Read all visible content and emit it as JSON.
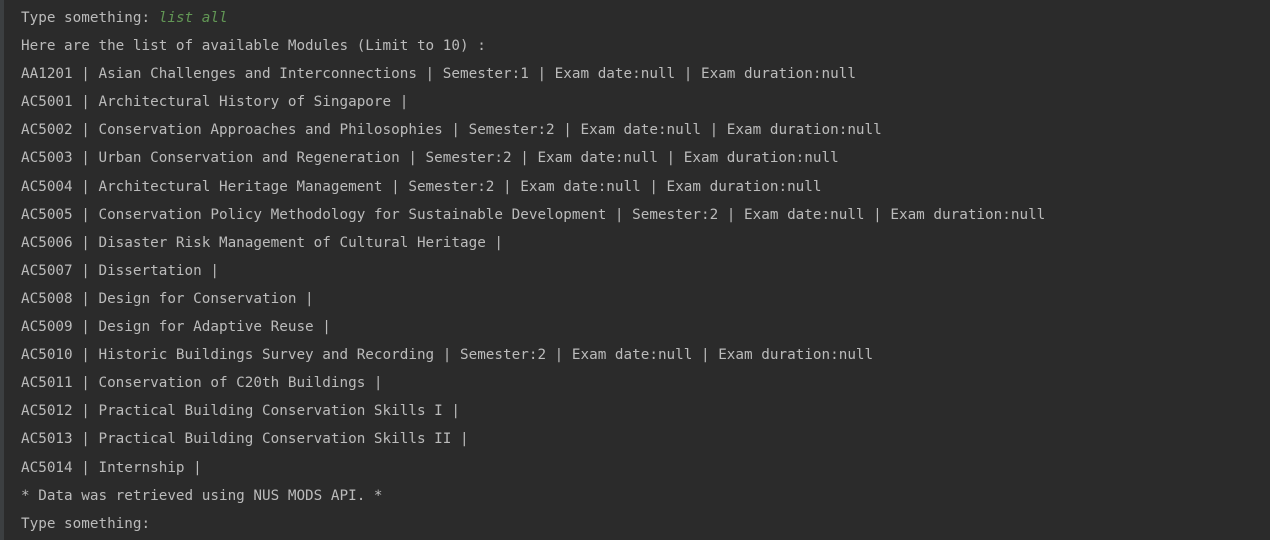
{
  "console": {
    "prompt_label": "Type something: ",
    "user_command": "list all",
    "header_line": "Here are the list of available Modules (Limit to 10) :",
    "modules": [
      "AA1201 | Asian Challenges and Interconnections | Semester:1 | Exam date:null | Exam duration:null",
      "AC5001 | Architectural History of Singapore |",
      "AC5002 | Conservation Approaches and Philosophies | Semester:2 | Exam date:null | Exam duration:null",
      "AC5003 | Urban Conservation and Regeneration | Semester:2 | Exam date:null | Exam duration:null",
      "AC5004 | Architectural Heritage Management | Semester:2 | Exam date:null | Exam duration:null",
      "AC5005 | Conservation Policy Methodology for Sustainable Development | Semester:2 | Exam date:null | Exam duration:null",
      "AC5006 | Disaster Risk Management of Cultural Heritage |",
      "AC5007 | Dissertation |",
      "AC5008 | Design for Conservation |",
      "AC5009 | Design for Adaptive Reuse |",
      "AC5010 | Historic Buildings Survey and Recording | Semester:2 | Exam date:null | Exam duration:null",
      "AC5011 | Conservation of C20th Buildings |",
      "AC5012 | Practical Building Conservation Skills I |",
      "AC5013 | Practical Building Conservation Skills II |",
      "AC5014 | Internship |"
    ],
    "footer_line": "* Data was retrieved using NUS MODS API. *",
    "final_prompt": "Type something:"
  },
  "colors": {
    "background": "#2b2b2b",
    "text": "#bbbbbb",
    "user_input": "#629755"
  }
}
